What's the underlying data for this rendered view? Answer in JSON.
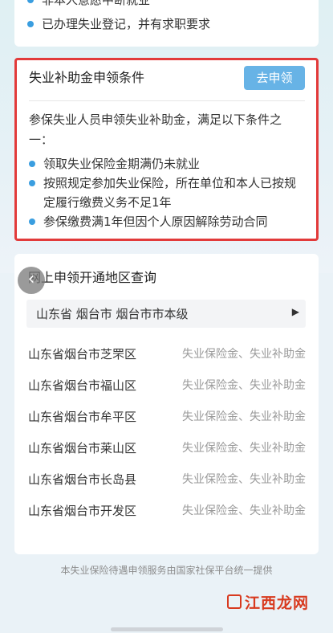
{
  "top_card": {
    "items": [
      "非本人意愿中断就业",
      "已办理失业登记，并有求职要求"
    ]
  },
  "conditions": {
    "title": "失业补助金申领条件",
    "apply_button": "去申领",
    "intro": "参保失业人员申领失业补助金，满足以下条件之一：",
    "items": [
      "领取失业保险金期满仍未就业",
      "按照规定参加失业保险，所在单位和本人已按规定履行缴费义务不足1年",
      "参保缴费满1年但因个人原因解除劳动合同"
    ]
  },
  "regions": {
    "title": "网上申领开通地区查询",
    "selected": "山东省  烟台市  烟台市市本级",
    "back_icon": "chevron-left-icon",
    "rows": [
      {
        "name": "山东省烟台市芝罘区",
        "types": "失业保险金、失业补助金"
      },
      {
        "name": "山东省烟台市福山区",
        "types": "失业保险金、失业补助金"
      },
      {
        "name": "山东省烟台市牟平区",
        "types": "失业保险金、失业补助金"
      },
      {
        "name": "山东省烟台市莱山区",
        "types": "失业保险金、失业补助金"
      },
      {
        "name": "山东省烟台市长岛县",
        "types": "失业保险金、失业补助金"
      },
      {
        "name": "山东省烟台市开发区",
        "types": "失业保险金、失业补助金"
      }
    ]
  },
  "footer": {
    "note": "本失业保险待遇申领服务由国家社保平台统一提供"
  },
  "watermark": {
    "text": "江西龙网"
  },
  "colors": {
    "accent": "#67b3e6",
    "bullet": "#3a9ee0",
    "highlight_border": "#e23a3a"
  }
}
